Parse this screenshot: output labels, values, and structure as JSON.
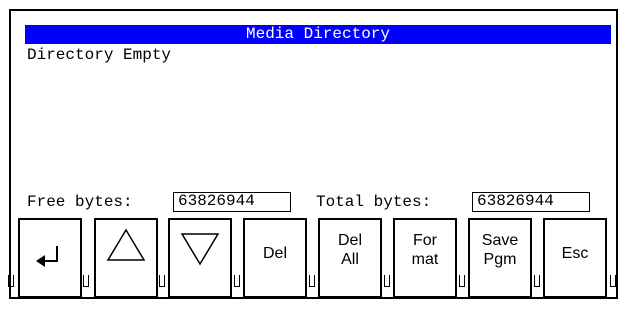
{
  "dialog": {
    "title": "Media Directory",
    "status": "Directory Empty"
  },
  "info": {
    "free_label": "Free bytes:",
    "free_value": "63826944",
    "total_label": "Total bytes:",
    "total_value": "63826944"
  },
  "softkeys": [
    {
      "name": "enter",
      "icon": "enter-return-arrow-icon",
      "label": ""
    },
    {
      "name": "up",
      "icon": "up-triangle-icon",
      "label": ""
    },
    {
      "name": "down",
      "icon": "down-triangle-icon",
      "label": ""
    },
    {
      "name": "del",
      "icon": "",
      "label": "Del"
    },
    {
      "name": "del-all",
      "icon": "",
      "label": "Del\nAll"
    },
    {
      "name": "format",
      "icon": "",
      "label": "For\nmat"
    },
    {
      "name": "save-pgm",
      "icon": "",
      "label": "Save\nPgm"
    },
    {
      "name": "esc",
      "icon": "",
      "label": "Esc"
    }
  ],
  "colors": {
    "title_bar_bg": "#0000ff",
    "title_bar_text": "#ffffff",
    "foreground": "#000000",
    "background": "#ffffff"
  }
}
